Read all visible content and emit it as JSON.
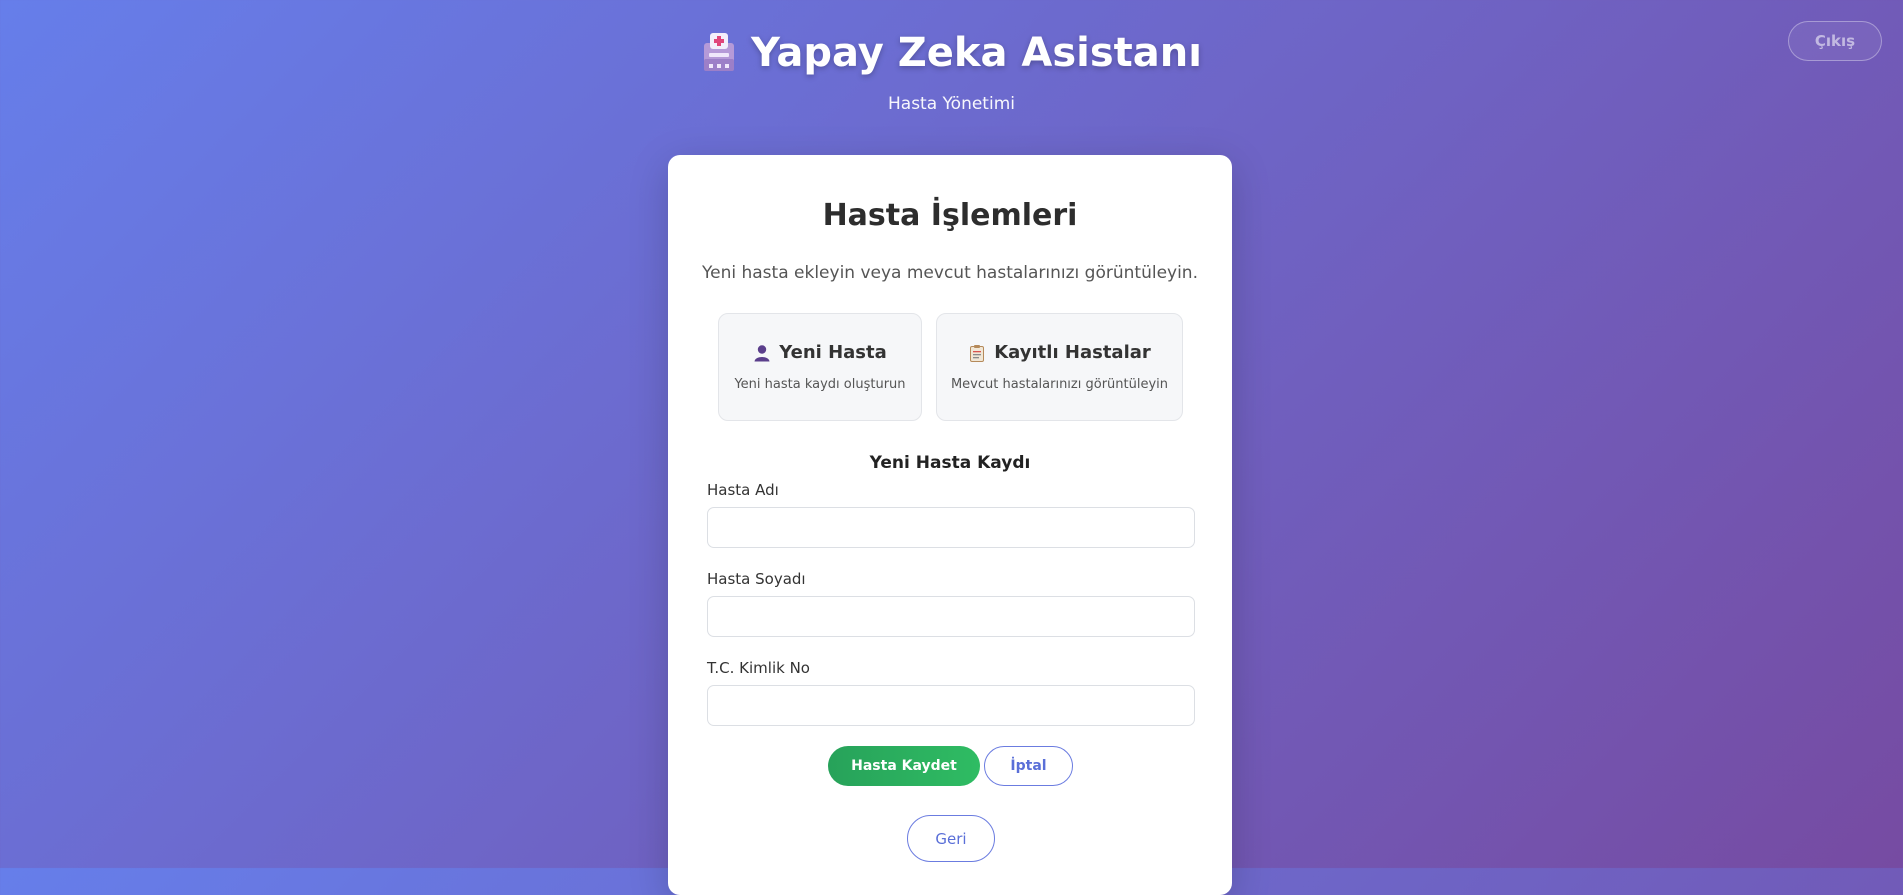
{
  "header": {
    "title": "Yapay Zeka Asistanı",
    "subtitle": "Hasta Yönetimi",
    "icon": "hospital-icon",
    "logout_label": "Çıkış"
  },
  "card": {
    "title": "Hasta İşlemleri",
    "description": "Yeni hasta ekleyin veya mevcut hastalarınızı görüntüleyin."
  },
  "options": [
    {
      "icon": "user-icon",
      "title": "Yeni Hasta",
      "description": "Yeni hasta kaydı oluşturun"
    },
    {
      "icon": "clipboard-icon",
      "title": "Kayıtlı Hastalar",
      "description": "Mevcut hastalarınızı görüntüleyin"
    }
  ],
  "form": {
    "title": "Yeni Hasta Kaydı",
    "fields": [
      {
        "label": "Hasta Adı",
        "value": "",
        "placeholder": ""
      },
      {
        "label": "Hasta Soyadı",
        "value": "",
        "placeholder": ""
      },
      {
        "label": "T.C. Kimlik No",
        "value": "",
        "placeholder": ""
      }
    ],
    "save_label": "Hasta Kaydet",
    "cancel_label": "İptal"
  },
  "back_label": "Geri",
  "colors": {
    "background_start": "#667eea",
    "background_end": "#764ba2",
    "accent": "#5a6fd8",
    "save_button": "#2fbc63"
  }
}
